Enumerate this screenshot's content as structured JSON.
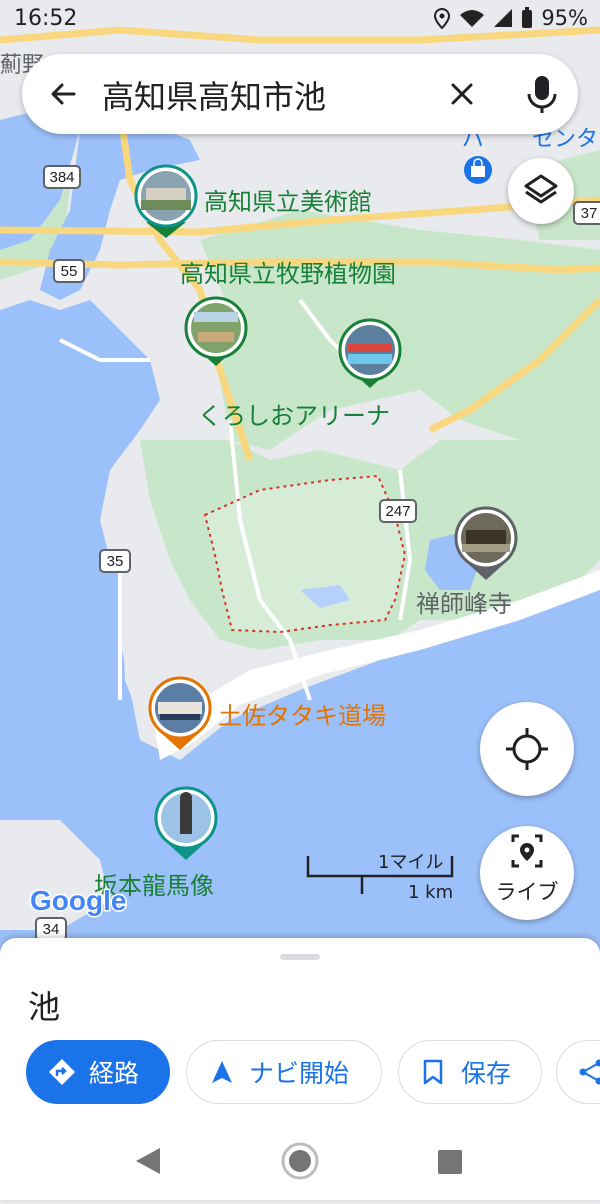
{
  "status_bar": {
    "time": "16:52",
    "battery": "95%"
  },
  "search": {
    "query": "高知県高知市池"
  },
  "map": {
    "places": [
      {
        "name": "高知県立美術館",
        "color": "#188038"
      },
      {
        "name": "高知県立牧野植物園",
        "color": "#188038"
      },
      {
        "name": "くろしおアリーナ",
        "color": "#188038"
      },
      {
        "name": "禅師峰寺",
        "color": "#5f6368"
      },
      {
        "name": "土佐タタキ道場",
        "color": "#e37400"
      },
      {
        "name": "坂本龍馬像",
        "color": "#188038"
      }
    ],
    "road_shields": [
      "384",
      "55",
      "35",
      "34",
      "247",
      "37"
    ],
    "partial_labels": [
      "薊野",
      "パ",
      "センタ"
    ],
    "google_logo": "Google"
  },
  "controls": {
    "live_label": "ライブ"
  },
  "scale": {
    "miles": "1マイル",
    "km": "1 km"
  },
  "bottom_sheet": {
    "place_name": "池",
    "actions": [
      {
        "label": "経路",
        "icon": "directions-icon"
      },
      {
        "label": "ナビ開始",
        "icon": "navigation-arrow-icon"
      },
      {
        "label": "保存",
        "icon": "bookmark-icon"
      },
      {
        "label": "",
        "icon": "share-icon"
      }
    ]
  },
  "colors": {
    "accent": "#1a73e8",
    "water": "#9cc0f9",
    "green_label": "#188038",
    "orange_label": "#e37400"
  }
}
